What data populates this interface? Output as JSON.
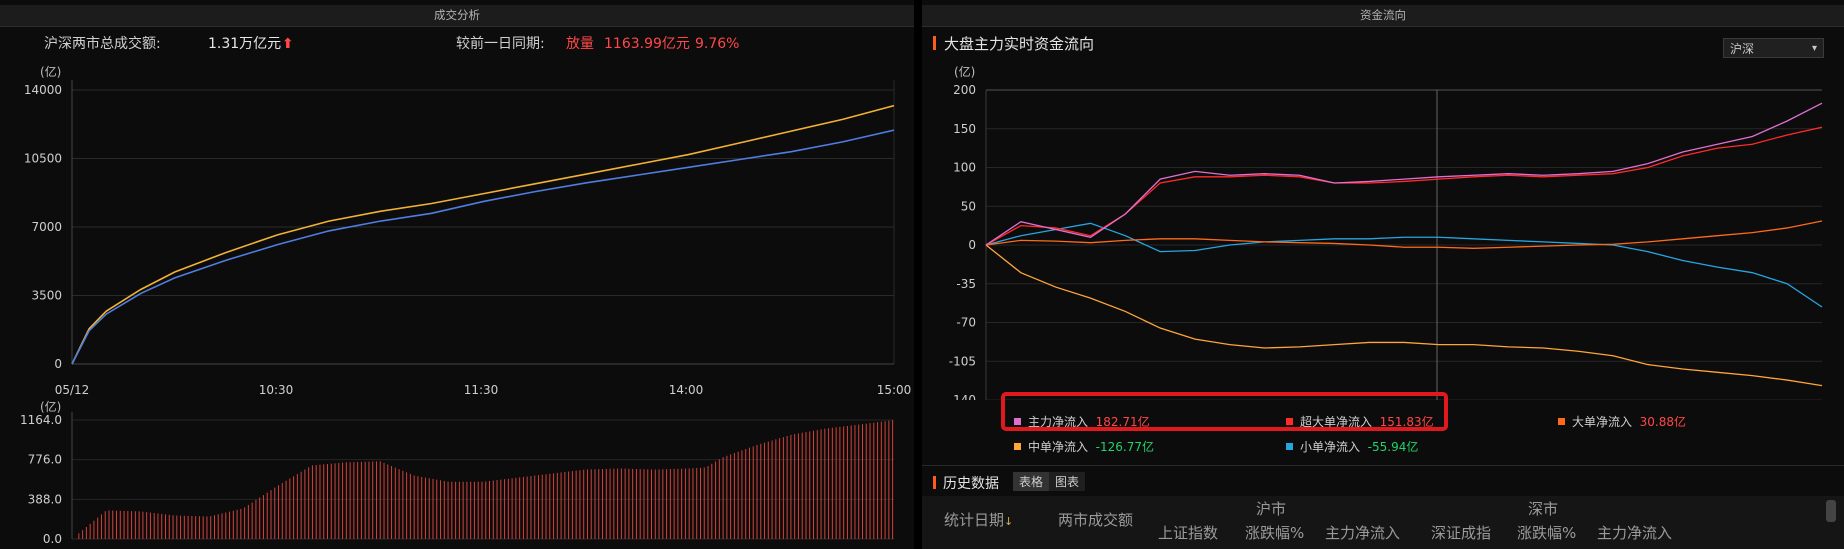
{
  "left_panel": {
    "title": "成交分析",
    "total_label": "沪深两市总成交额:",
    "total_value": "1.31万亿元",
    "up_arrow": "⬆",
    "compare_label": "较前一日同期:",
    "compare_tag": "放量",
    "compare_amount": "1163.99亿元",
    "compare_pct": "9.76%"
  },
  "right_panel": {
    "title": "资金流向",
    "chart_title": "大盘主力实时资金流向",
    "market_select": "沪深",
    "legend": [
      {
        "label": "主力净流入",
        "value": "182.71亿",
        "color": "#e070d0",
        "value_color": "#ff4747"
      },
      {
        "label": "超大单净流入",
        "value": "151.83亿",
        "color": "#ff2a2a",
        "value_color": "#ff4747"
      },
      {
        "label": "大单净流入",
        "value": "30.88亿",
        "color": "#ff6a1a",
        "value_color": "#ff4747"
      },
      {
        "label": "中单净流入",
        "value": "-126.77亿",
        "color": "#ffa53a",
        "value_color": "#21d36a"
      },
      {
        "label": "小单净流入",
        "value": "-55.94亿",
        "color": "#27a5e0",
        "value_color": "#21d36a"
      }
    ],
    "history": {
      "title": "历史数据",
      "tabs": [
        "表格",
        "图表"
      ],
      "columns": [
        "统计日期",
        "两市成交额"
      ],
      "groups": [
        "沪市",
        "深市"
      ],
      "sh_cols": [
        "上证指数",
        "涨跌幅%",
        "主力净流入"
      ],
      "sz_cols": [
        "深证成指",
        "涨跌幅%",
        "主力净流入"
      ]
    }
  },
  "chart_data": [
    {
      "type": "line",
      "title": "",
      "ylabel": "(亿)",
      "x_ticks": [
        "05/12",
        "10:30",
        "11:30",
        "14:00",
        "15:00"
      ],
      "y_ticks": [
        "0",
        "3500",
        "7000",
        "10500",
        "14000"
      ],
      "ylim": [
        0,
        14000
      ],
      "x": [
        0,
        5,
        10,
        20,
        30,
        45,
        60,
        75,
        90,
        105,
        120,
        135,
        150,
        165,
        180,
        195,
        210,
        225,
        240
      ],
      "series": [
        {
          "color": "#f2b233",
          "values": [
            0,
            1800,
            2700,
            3800,
            4700,
            5700,
            6600,
            7300,
            7800,
            8200,
            8700,
            9200,
            9700,
            10200,
            10700,
            11300,
            11900,
            12500,
            13200
          ]
        },
        {
          "color": "#4f7de0",
          "values": [
            0,
            1700,
            2550,
            3600,
            4400,
            5300,
            6100,
            6800,
            7300,
            7700,
            8300,
            8800,
            9250,
            9650,
            10050,
            10450,
            10850,
            11350,
            11950
          ]
        }
      ]
    },
    {
      "type": "bar",
      "title": "",
      "ylabel": "(亿)",
      "y_ticks": [
        "0.0",
        "388.0",
        "776.0",
        "1164.0"
      ],
      "ylim": [
        0,
        1164
      ],
      "x": [
        0,
        10,
        20,
        25,
        30,
        40,
        50,
        60,
        70,
        80,
        90,
        100,
        110,
        120,
        130,
        140,
        150,
        160,
        170,
        180,
        185,
        190,
        200,
        210,
        220,
        230,
        240
      ],
      "values": [
        0,
        280,
        270,
        250,
        230,
        220,
        300,
        520,
        720,
        750,
        760,
        620,
        560,
        560,
        600,
        640,
        680,
        690,
        680,
        690,
        700,
        800,
        920,
        1020,
        1080,
        1120,
        1164
      ],
      "color": "#d4423a"
    },
    {
      "type": "line",
      "title": "大盘主力实时资金流向",
      "ylabel": "(亿)",
      "x_ticks": [
        "05/12",
        "10:30",
        "11:30",
        "14:00",
        "15:00"
      ],
      "y_ticks": [
        "200",
        "150",
        "100",
        "50",
        "0",
        "-35",
        "-70",
        "-105",
        "-140"
      ],
      "ylim": [
        -140,
        200
      ],
      "x": [
        0,
        10,
        20,
        30,
        40,
        50,
        60,
        70,
        80,
        90,
        100,
        110,
        120,
        130,
        140,
        150,
        160,
        170,
        180,
        190,
        200,
        210,
        220,
        230,
        240
      ],
      "series": [
        {
          "name": "主力净流入",
          "color": "#e070d0",
          "values": [
            0,
            30,
            20,
            10,
            40,
            85,
            95,
            90,
            92,
            90,
            80,
            82,
            85,
            88,
            90,
            92,
            90,
            92,
            95,
            105,
            120,
            130,
            140,
            160,
            183
          ]
        },
        {
          "name": "超大单净流入",
          "color": "#ff2a2a",
          "values": [
            0,
            25,
            22,
            12,
            40,
            80,
            88,
            88,
            90,
            88,
            80,
            80,
            82,
            85,
            88,
            90,
            88,
            90,
            92,
            100,
            115,
            125,
            130,
            142,
            152
          ]
        },
        {
          "name": "大单净流入",
          "color": "#ff6a1a",
          "values": [
            0,
            6,
            5,
            3,
            6,
            8,
            8,
            6,
            4,
            3,
            2,
            0,
            -2,
            -2,
            -3,
            -2,
            -1,
            0,
            1,
            4,
            8,
            12,
            16,
            22,
            31
          ]
        },
        {
          "name": "中单净流入",
          "color": "#ffa53a",
          "values": [
            0,
            -25,
            -38,
            -48,
            -60,
            -75,
            -85,
            -90,
            -93,
            -92,
            -90,
            -88,
            -88,
            -90,
            -90,
            -92,
            -93,
            -96,
            -100,
            -108,
            -112,
            -115,
            -118,
            -122,
            -127
          ]
        },
        {
          "name": "小单净流入",
          "color": "#27a5e0",
          "values": [
            0,
            12,
            20,
            28,
            12,
            -6,
            -5,
            0,
            4,
            6,
            8,
            8,
            10,
            10,
            8,
            6,
            4,
            2,
            0,
            -6,
            -14,
            -20,
            -25,
            -35,
            -56
          ]
        }
      ]
    }
  ]
}
